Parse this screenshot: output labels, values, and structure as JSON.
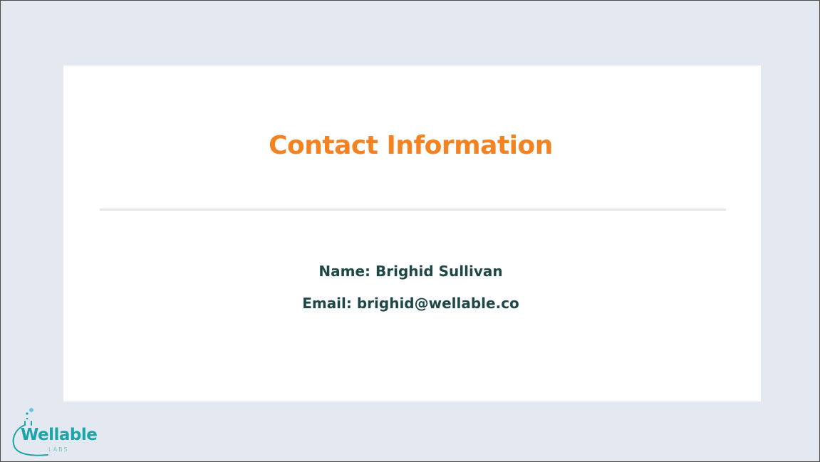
{
  "slide": {
    "title": "Contact Information",
    "contact": {
      "name_line": "Name: Brighid Sullivan",
      "email_line": "Email: brighid@wellable.co"
    }
  },
  "logo": {
    "word": "Wellable",
    "sub": "LABS",
    "icon": "flask-icon"
  },
  "colors": {
    "background": "#e4e8f0",
    "card": "#ffffff",
    "title": "#f58220",
    "contact_text": "#1e4848",
    "logo_teal": "#1aa6a8",
    "logo_bubble": "#6fc3e0"
  }
}
